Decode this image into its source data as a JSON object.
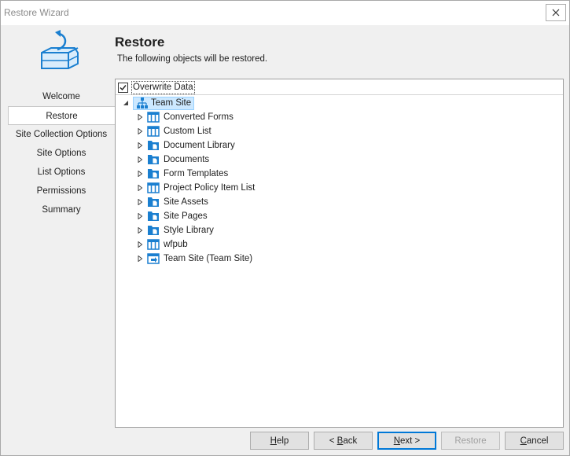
{
  "window": {
    "title": "Restore Wizard",
    "close_icon": "close-icon"
  },
  "header": {
    "icon": "restore-database-icon",
    "title": "Restore",
    "subtitle": "The following objects will be restored."
  },
  "nav": {
    "items": [
      {
        "label": "Welcome",
        "active": false
      },
      {
        "label": "Restore",
        "active": true
      },
      {
        "label": "Site Collection Options",
        "active": false
      },
      {
        "label": "Site Options",
        "active": false
      },
      {
        "label": "List Options",
        "active": false
      },
      {
        "label": "Permissions",
        "active": false
      },
      {
        "label": "Summary",
        "active": false
      }
    ]
  },
  "tree": {
    "overwrite": {
      "label": "Overwrite Data",
      "checked": true
    },
    "root": {
      "label": "Team Site",
      "icon": "site-hierarchy-icon",
      "expanded": true
    },
    "children": [
      {
        "label": "Converted Forms",
        "icon": "list-icon"
      },
      {
        "label": "Custom List",
        "icon": "list-icon"
      },
      {
        "label": "Document Library",
        "icon": "document-library-icon"
      },
      {
        "label": "Documents",
        "icon": "document-library-icon"
      },
      {
        "label": "Form Templates",
        "icon": "document-library-icon"
      },
      {
        "label": "Project Policy Item List",
        "icon": "list-icon"
      },
      {
        "label": "Site Assets",
        "icon": "document-library-icon"
      },
      {
        "label": "Site Pages",
        "icon": "document-library-icon"
      },
      {
        "label": "Style Library",
        "icon": "document-library-icon"
      },
      {
        "label": "wfpub",
        "icon": "list-icon"
      },
      {
        "label": "Team Site (Team Site)",
        "icon": "subsite-icon"
      }
    ]
  },
  "footer": {
    "help": {
      "label_pre": "",
      "accel": "H",
      "label_post": "elp"
    },
    "back": {
      "label_pre": "< ",
      "accel": "B",
      "label_post": "ack"
    },
    "next": {
      "label_pre": "",
      "accel": "N",
      "label_post": "ext >"
    },
    "restore": {
      "label": "Restore"
    },
    "cancel": {
      "label_pre": "",
      "accel": "C",
      "label_post": "ancel"
    }
  },
  "colors": {
    "accent": "#0078d7",
    "selection": "#cce8ff",
    "icon_blue": "#1a7fd0"
  }
}
